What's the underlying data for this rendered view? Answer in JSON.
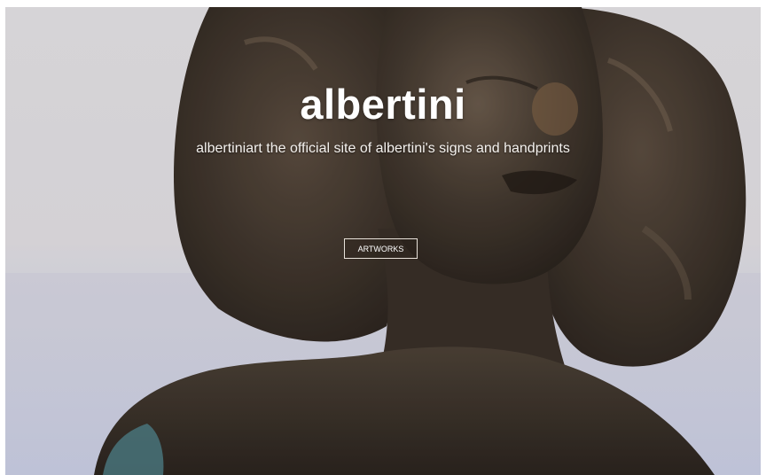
{
  "hero": {
    "title": "albertini",
    "tagline": "albertiniart the official site of albertini's signs and handprints",
    "cta_label": "ARTWORKS",
    "image_alt": "bronze bust sculpture"
  },
  "colors": {
    "background": "#e7e4e9",
    "bronze": "#3e342c",
    "patina": "#4f7e86",
    "text": "#ffffff"
  }
}
